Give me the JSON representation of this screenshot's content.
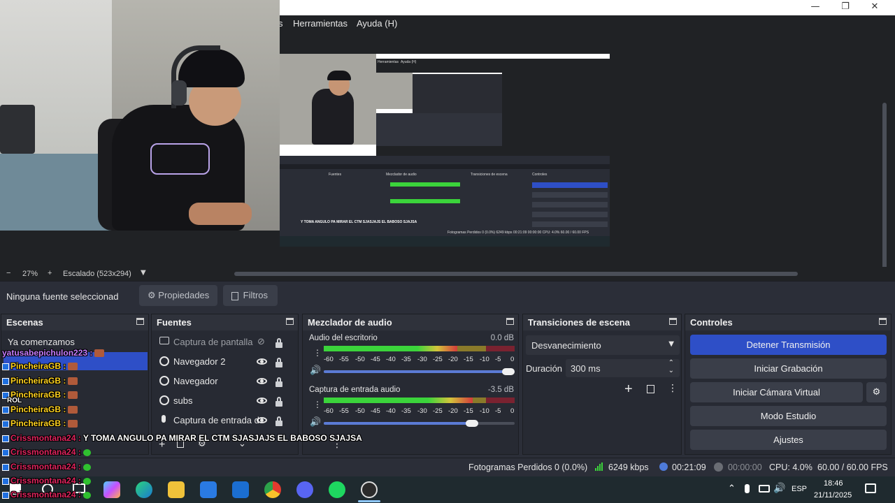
{
  "menu": {
    "partial_label": "s",
    "items": [
      "Herramientas",
      "Ayuda (H)"
    ]
  },
  "window_controls": {
    "minimize": "—",
    "maximize": "❐",
    "close": "✕"
  },
  "preview_nested": {
    "menu_items": [
      "Herramientas",
      "Ayuda (H)"
    ],
    "docks": [
      "Fuentes",
      "Mezclador de audio",
      "Transiciones de escena",
      "Controles"
    ],
    "chat_line": "Y TOMA ANGULO PA MIRAR EL CTM SJASJAJS EL BABOSO SJAJSA",
    "status": "Fotogramas Perdidos 0 (0.0%)   6249 kbps   00:21:09   00:00:00   CPU: 4.0%   60.00 / 60.00 FPS"
  },
  "zoom": {
    "minus": "−",
    "value": "27%",
    "plus": "+",
    "scale_label": "Escalado (523x294)"
  },
  "source_toolbar": {
    "selection": "Ninguna fuente seleccionad",
    "properties": "Propiedades",
    "filters": "Filtros"
  },
  "scenes": {
    "title": "Escenas",
    "items": [
      "Ya comenzamos"
    ]
  },
  "sources": {
    "title": "Fuentes",
    "items": [
      {
        "label": "Captura de pantalla",
        "visible": false,
        "icon": "monitor-icon"
      },
      {
        "label": "Navegador 2",
        "visible": true,
        "icon": "globe-icon"
      },
      {
        "label": "Navegador",
        "visible": true,
        "icon": "globe-icon"
      },
      {
        "label": "subs",
        "visible": true,
        "icon": "globe-icon"
      },
      {
        "label": "Captura de entrada d",
        "visible": true,
        "icon": "microphone-icon"
      }
    ]
  },
  "mixer": {
    "title": "Mezclador de audio",
    "ticks": [
      "-60",
      "-55",
      "-50",
      "-45",
      "-40",
      "-35",
      "-30",
      "-25",
      "-20",
      "-15",
      "-10",
      "-5",
      "0"
    ],
    "channels": [
      {
        "name": "Audio del escritorio",
        "db": "0.0 dB",
        "level": 0.7,
        "volume": 1.0
      },
      {
        "name": "Captura de entrada audio",
        "db": "-3.5 dB",
        "level": 0.78,
        "volume": 0.81
      }
    ]
  },
  "transitions": {
    "title": "Transiciones de escena",
    "selected": "Desvanecimiento",
    "duration_label": "Duración",
    "duration_value": "300 ms"
  },
  "controls": {
    "title": "Controles",
    "stop_stream": "Detener Transmisión",
    "start_recording": "Iniciar Grabación",
    "start_virtual_cam": "Iniciar Cámara Virtual",
    "studio_mode": "Modo Estudio",
    "settings": "Ajustes",
    "accent": "#2e4fc7"
  },
  "statusbar": {
    "dropped": "Fotogramas Perdidos 0 (0.0%)",
    "bitrate": "6249 kbps",
    "stream_time": "00:21:09",
    "record_time": "00:00:00",
    "cpu": "CPU: 4.0%",
    "fps": "60.00 / 60.00 FPS"
  },
  "chat": [
    {
      "user": "yatusabepichulon223 :",
      "color": "#c77dff",
      "msg": ""
    },
    {
      "user": "PincheiraGB :",
      "color": "#ffd21f",
      "msg": ""
    },
    {
      "user": "PincheiraGB :",
      "color": "#ffd21f",
      "msg": ""
    },
    {
      "user": "PincheiraGB :",
      "color": "#ffd21f",
      "msg": ""
    },
    {
      "user": "PincheiraGB :",
      "color": "#ffd21f",
      "msg": ""
    },
    {
      "user": "PincheiraGB :",
      "color": "#ffd21f",
      "msg": ""
    },
    {
      "user": "Crissmontana24 :",
      "color": "#e0245e",
      "msg": "Y TOMA ANGULO PA MIRAR EL CTM SJASJAJS EL BABOSO SJAJSA"
    },
    {
      "user": "Crissmontana24 :",
      "color": "#e0245e",
      "msg": ""
    },
    {
      "user": "Crissmontana24 :",
      "color": "#e0245e",
      "msg": ""
    },
    {
      "user": "Crissmontana24 :",
      "color": "#e0245e",
      "msg": ""
    },
    {
      "user": "Crissmontana24 :",
      "color": "#e0245e",
      "msg": ""
    }
  ],
  "chat_extra": {
    "rol": "ROL"
  },
  "taskbar": {
    "language": "ESP",
    "time": "18:46",
    "date": "21/11/2025",
    "apps": [
      "copilot-icon",
      "edge-icon",
      "file-explorer-icon",
      "store-icon",
      "outlook-icon",
      "chrome-icon",
      "discord-icon",
      "spotify-icon",
      "obs-icon"
    ]
  }
}
